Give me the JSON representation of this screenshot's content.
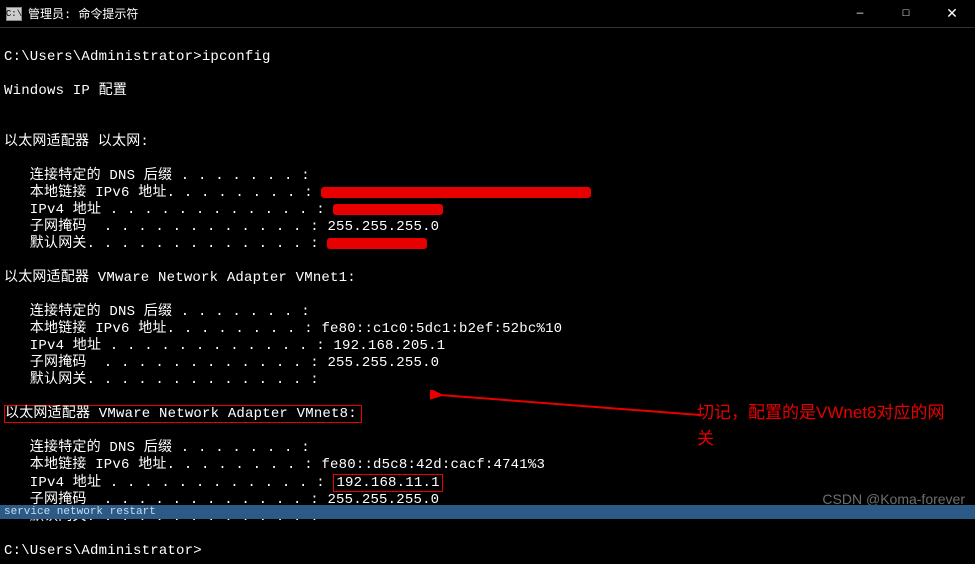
{
  "titlebar": {
    "icon_label": "C:\\",
    "title": "管理员: 命令提示符"
  },
  "window_controls": {
    "minimize": "—",
    "maximize": "□",
    "close": "✕"
  },
  "prompt1": "C:\\Users\\Administrator>ipconfig",
  "heading": "Windows IP 配置",
  "adapter1": {
    "header": "以太网适配器 以太网:",
    "dns_suffix_label": "   连接特定的 DNS 后缀 . . . . . . . :",
    "ipv6_label": "   本地链接 IPv6 地址. . . . . . . . : ",
    "ipv4_label": "   IPv4 地址 . . . . . . . . . . . . : ",
    "subnet_label": "   子网掩码  . . . . . . . . . . . . : ",
    "subnet_value": "255.255.255.0",
    "gateway_label": "   默认网关. . . . . . . . . . . . . : "
  },
  "adapter2": {
    "header": "以太网适配器 VMware Network Adapter VMnet1:",
    "dns_suffix_label": "   连接特定的 DNS 后缀 . . . . . . . :",
    "ipv6_label": "   本地链接 IPv6 地址. . . . . . . . : ",
    "ipv6_value": "fe80::c1c0:5dc1:b2ef:52bc%10",
    "ipv4_label": "   IPv4 地址 . . . . . . . . . . . . : ",
    "ipv4_value": "192.168.205.1",
    "subnet_label": "   子网掩码  . . . . . . . . . . . . : ",
    "subnet_value": "255.255.255.0",
    "gateway_label": "   默认网关. . . . . . . . . . . . . :"
  },
  "adapter3": {
    "header": "以太网适配器 VMware Network Adapter VMnet8:",
    "dns_suffix_label": "   连接特定的 DNS 后缀 . . . . . . . :",
    "ipv6_label": "   本地链接 IPv6 地址. . . . . . . . : ",
    "ipv6_value": "fe80::d5c8:42d:cacf:4741%3",
    "ipv4_label": "   IPv4 地址 . . . . . . . . . . . . : ",
    "ipv4_value": "192.168.11.1",
    "subnet_label": "   子网掩码  . . . . . . . . . . . . : ",
    "subnet_value": "255.255.255.0",
    "gateway_label": "   默认网关. . . . . . . . . . . . . :"
  },
  "prompt2": "C:\\Users\\Administrator>",
  "annotation": "切记，配置的是VWnet8对应的网关",
  "watermark": "CSDN @Koma-forever",
  "footer": "service network restart"
}
